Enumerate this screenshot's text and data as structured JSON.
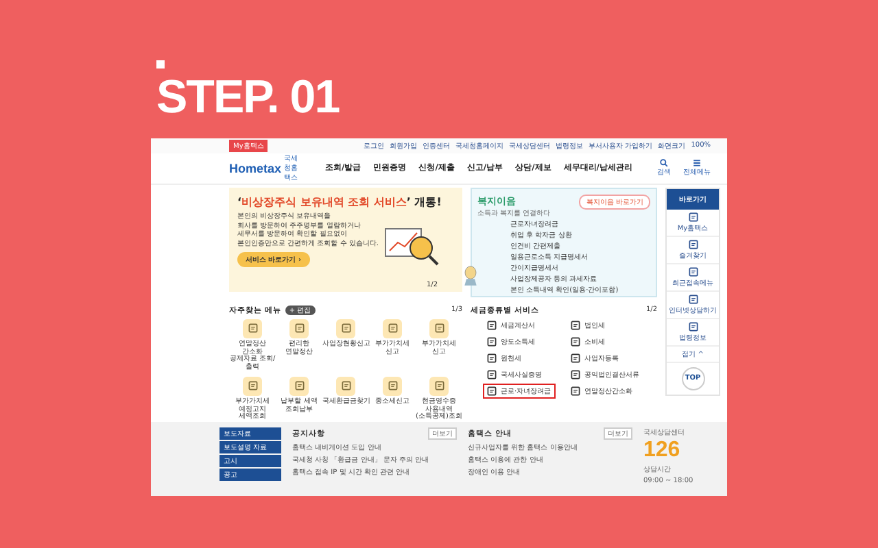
{
  "step_label": "STEP. 01",
  "site": {
    "badge": "My홈택스",
    "util_links": [
      "로그인",
      "회원가입",
      "인증센터",
      "국세청홈페이지",
      "국세상담센터",
      "법령정보",
      "부서사용자 가입하기"
    ],
    "zoom": {
      "label": "화면크기",
      "value": "100%"
    },
    "logo": {
      "text": "Hometax",
      "sub": "국세청홈택스"
    },
    "nav": [
      "조회/발급",
      "민원증명",
      "신청/제출",
      "신고/납부",
      "상담/제보",
      "세무대리/납세관리"
    ],
    "nav_tools": [
      {
        "kind": "search",
        "label": "검색"
      },
      {
        "kind": "menu",
        "label": "전체메뉴"
      }
    ],
    "banner": {
      "title": "‘**비상장주식 보유내역 조회 서비스**’ 개통!",
      "body": [
        "본인의 비상장주식 보유내역을",
        "회사를 방문하여 주주명부를 열람하거나",
        "세무서를 방문하여 확인할 필요없이",
        "본인인증만으로 간편하게 조회할 수 있습니다."
      ],
      "button": "서비스 바로가기 ›",
      "pager": "1/2"
    },
    "welfare": {
      "title": "복지이음",
      "subtitle": "소득과 복지를 연결하다",
      "button": "복지이음 바로가기",
      "items": [
        "근로자녀장려금",
        "취업 후 학자금 상환",
        "인건비 간편제출",
        "일용근로소득 지급명세서",
        "간이지급명세서",
        "사업장제공자 등의 과세자료",
        "본인 소득내역 확인(일용·간이포함)"
      ]
    },
    "quick": {
      "title": "바로가기",
      "items": [
        "My홈택스",
        "즐겨찾기",
        "최근접속메뉴",
        "인터넷상담하기",
        "법령정보"
      ],
      "fold": "접기 ^",
      "top": "TOP"
    },
    "frequent": {
      "title": "자주찾는 메뉴",
      "edit": "+ 편집",
      "pager": "1/3",
      "items": [
        "연말정산 간소화 공제자료 조회/출력",
        "편리한 연말정산",
        "사업장현황신고",
        "부가가치세 신고",
        "부가가치세 신고",
        "부가가치세 예정고지 세액조회",
        "납부할 세액 조회납부",
        "국세환급금찾기",
        "종소세신고",
        "현금영수증 사용내역(소득공제)조회"
      ]
    },
    "services": {
      "title": "세금종류별 서비스",
      "pager": "1/2",
      "items": [
        {
          "label": "세금계산서",
          "highlighted": false
        },
        {
          "label": "법인세",
          "highlighted": false
        },
        {
          "label": "양도소득세",
          "highlighted": false
        },
        {
          "label": "소비세",
          "highlighted": false
        },
        {
          "label": "원천세",
          "highlighted": false
        },
        {
          "label": "사업자등록",
          "highlighted": false
        },
        {
          "label": "국세사실증명",
          "highlighted": false
        },
        {
          "label": "공익법인결산서류",
          "highlighted": false
        },
        {
          "label": "근로·자녀장려금",
          "highlighted": true
        },
        {
          "label": "연말정산간소화",
          "highlighted": false
        }
      ]
    },
    "footer": {
      "links": [
        "보도자료",
        "보도설명 자료",
        "고시",
        "공고"
      ],
      "notices": {
        "title": "공지사항",
        "more": "더보기",
        "items": [
          "홈택스 내비게이션 도입 안내",
          "국세청 사칭 「환급금 안내」 문자 주의 안내",
          "홈택스 접속 IP 및 시간 확인 관련 안내"
        ]
      },
      "guide": {
        "title": "홈택스 안내",
        "more": "더보기",
        "items": [
          "신규사업자를 위한 홈택스 이용안내",
          "홈택스 이용에 관한 안내",
          "장애인 이용 안내"
        ]
      },
      "call": {
        "caption": "국세상담센터",
        "number": "126",
        "hours_label": "상담시간",
        "hours": "09:00 ~ 18:00"
      }
    }
  }
}
